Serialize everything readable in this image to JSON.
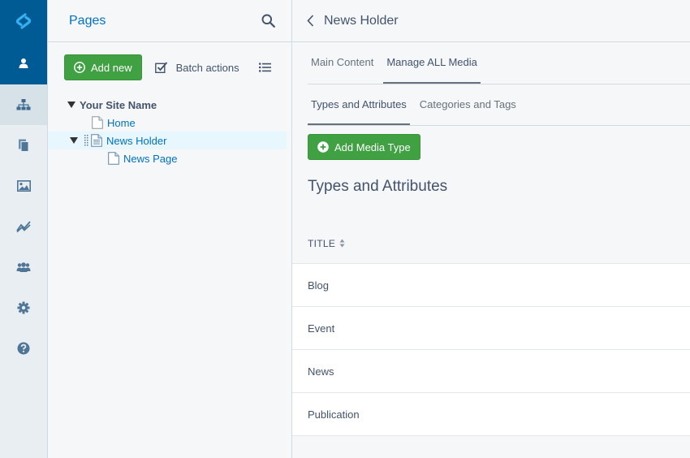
{
  "tree_panel": {
    "title": "Pages",
    "add_new_label": "Add new",
    "batch_actions_label": "Batch actions",
    "root": "Your Site Name",
    "nodes": [
      {
        "label": "Home"
      },
      {
        "label": "News Holder"
      },
      {
        "label": "News Page"
      }
    ]
  },
  "main": {
    "title": "News Holder",
    "tabs": [
      {
        "label": "Main Content"
      },
      {
        "label": "Manage ALL Media"
      }
    ],
    "subtabs": [
      {
        "label": "Types and Attributes"
      },
      {
        "label": "Categories and Tags"
      }
    ],
    "add_media_label": "Add Media Type",
    "section_title": "Types and Attributes",
    "grid": {
      "column": "TITLE",
      "rows": [
        "Blog",
        "Event",
        "News",
        "Publication"
      ]
    }
  },
  "icons": {
    "logo": "silverstripe-logo-icon",
    "rail": [
      "profile-icon",
      "sitetree-icon",
      "files-icon",
      "image-icon",
      "reports-icon",
      "security-icon",
      "settings-icon",
      "help-icon"
    ]
  },
  "colors": {
    "brand": "#005a93",
    "link": "#0071c4",
    "primary_button": "#3fa142",
    "selected_node": "#e8f6fd"
  }
}
